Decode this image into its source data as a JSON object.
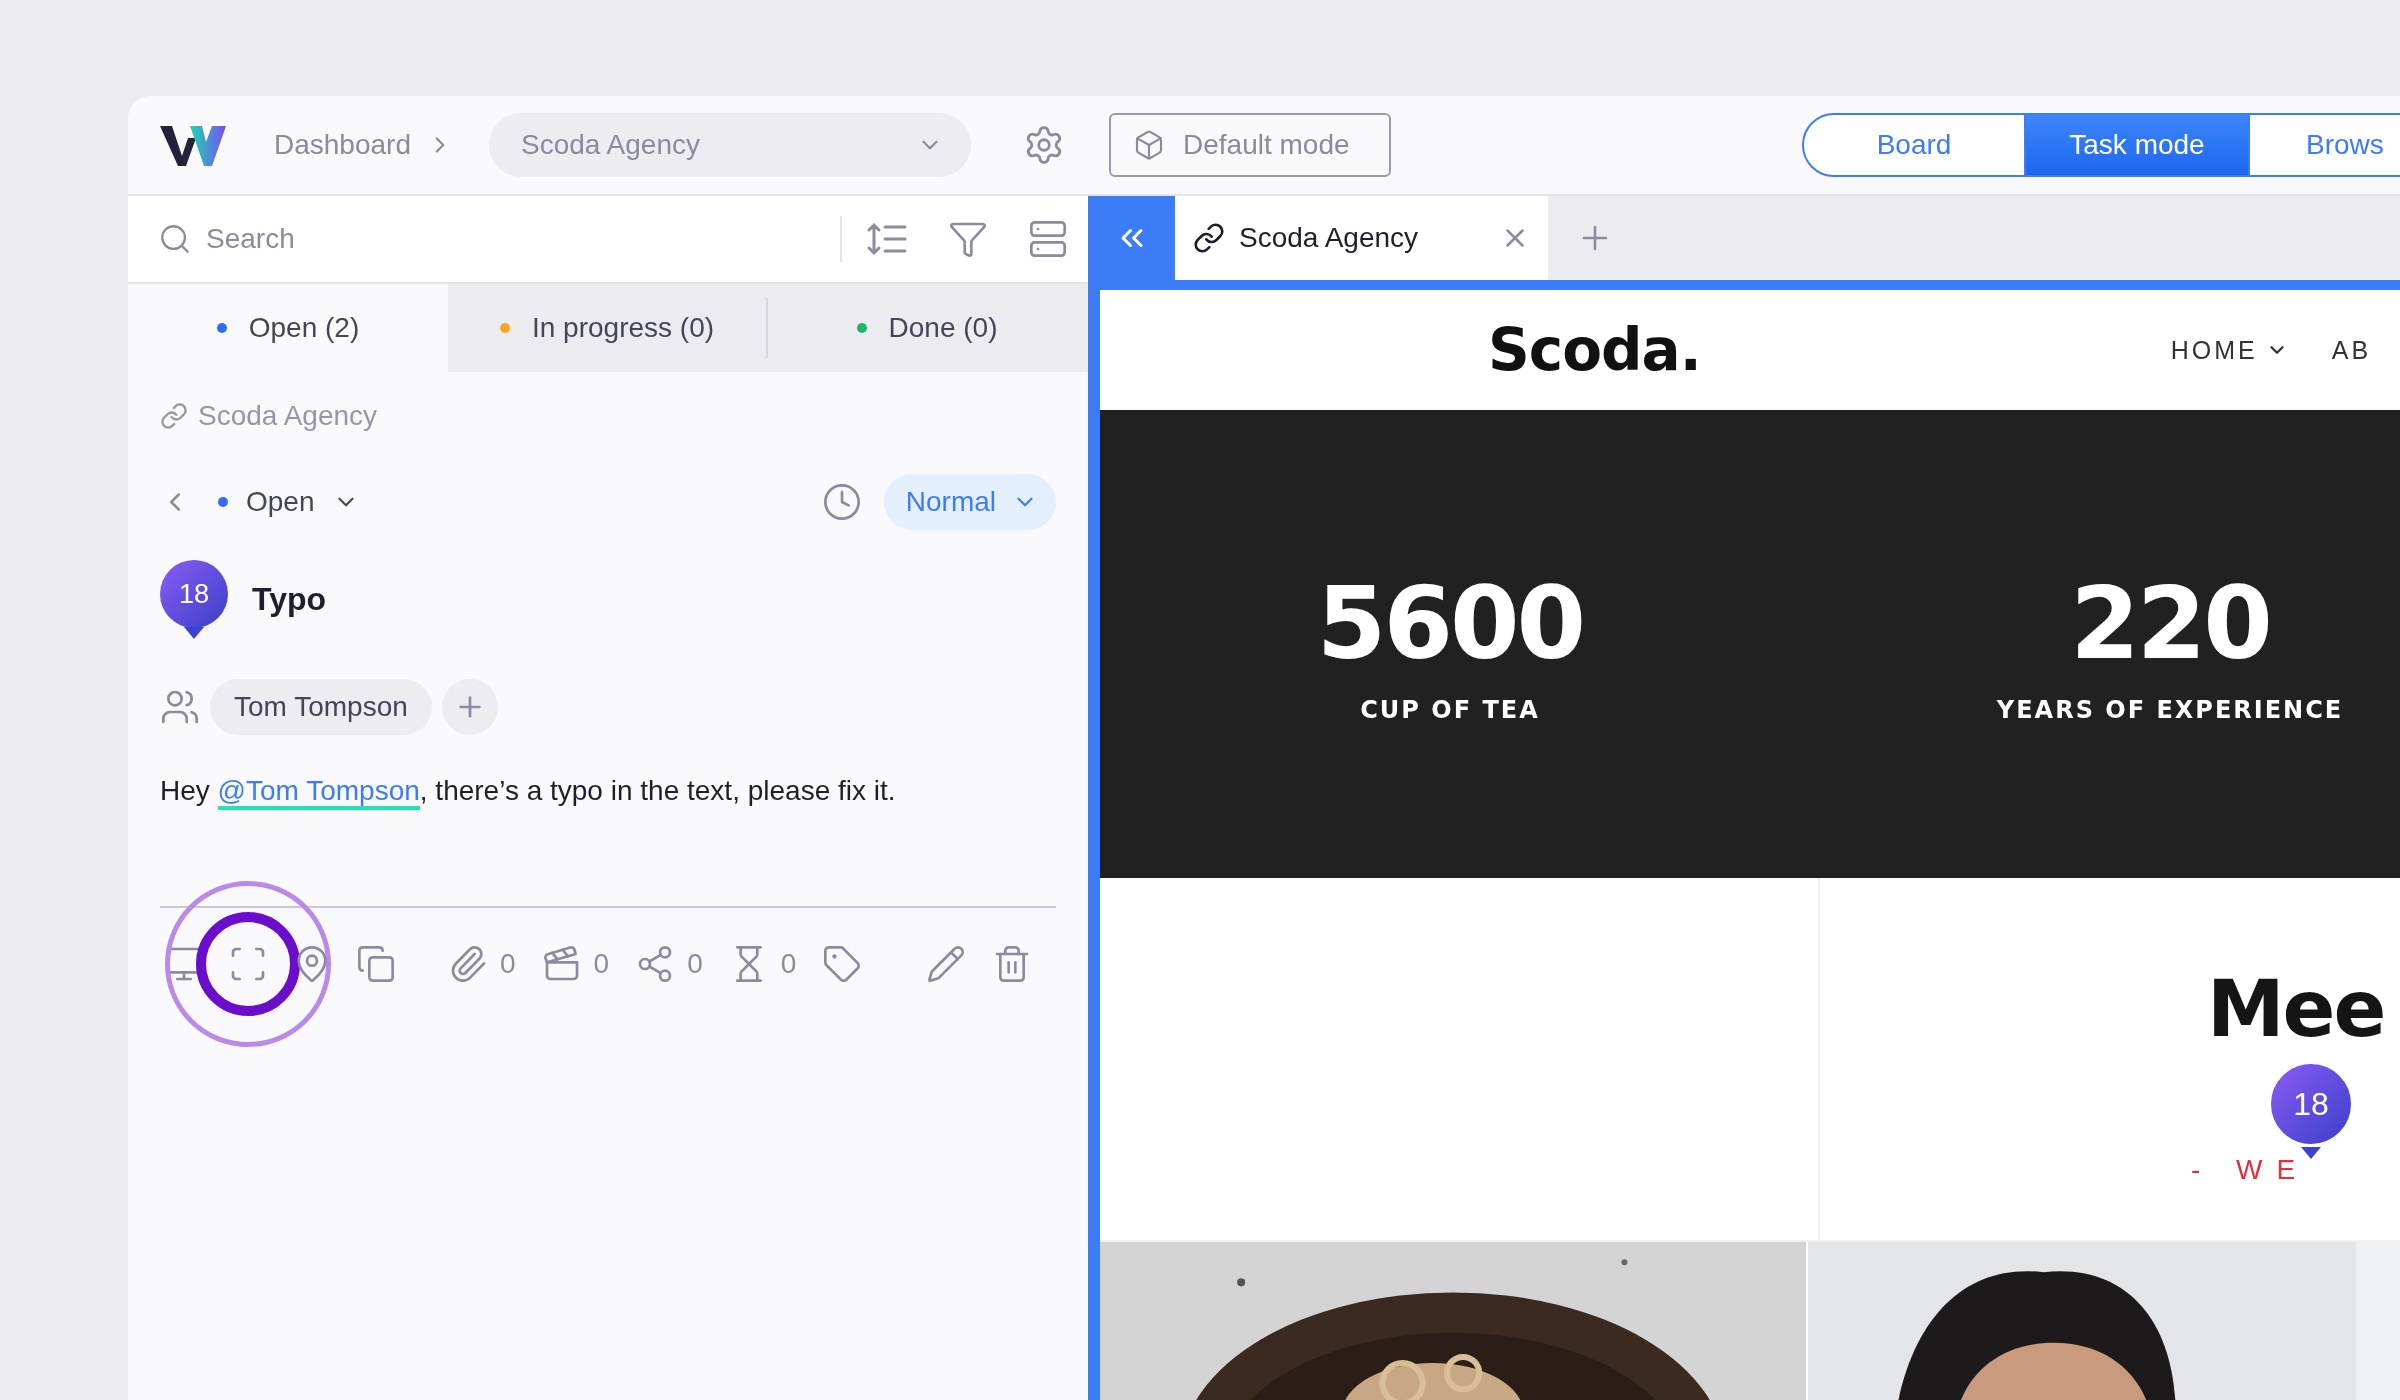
{
  "header": {
    "breadcrumb": "Dashboard",
    "project": "Scoda Agency",
    "mode_button": "Default mode",
    "view_tabs": [
      {
        "label": "Board",
        "selected": false
      },
      {
        "label": "Task mode",
        "selected": true
      },
      {
        "label": "Brows",
        "selected": false
      }
    ]
  },
  "sidebar": {
    "search": {
      "placeholder": "Search"
    },
    "status_tabs": [
      {
        "label": "Open (2)",
        "color": "#2f6bff",
        "selected": true
      },
      {
        "label": "In progress (0)",
        "color": "#f5a623",
        "selected": false
      },
      {
        "label": "Done (0)",
        "color": "#1fb46b",
        "selected": false
      }
    ],
    "task": {
      "link": "Scoda Agency",
      "status": "Open",
      "priority": "Normal",
      "number": "18",
      "title": "Typo",
      "assignees": [
        "Tom Tompson"
      ],
      "message": {
        "before": "Hey ",
        "mention": "@Tom Tompson",
        "after": ", there’s a typo in the text, please fix it."
      },
      "tools": [
        {
          "kind": "monitor",
          "highlighted": false
        },
        {
          "kind": "screenshot",
          "highlighted": true
        },
        {
          "kind": "pin",
          "highlighted": false
        },
        {
          "kind": "copy",
          "highlighted": false
        }
      ],
      "counters": [
        {
          "kind": "attachment",
          "count": "0"
        },
        {
          "kind": "video",
          "count": "0"
        },
        {
          "kind": "share",
          "count": "0"
        },
        {
          "kind": "time",
          "count": "0"
        }
      ],
      "actions": [
        {
          "kind": "tag"
        },
        {
          "kind": "edit"
        },
        {
          "kind": "delete"
        }
      ]
    }
  },
  "browser": {
    "tabs": [
      {
        "label": "Scoda Agency"
      }
    ],
    "site": {
      "logo": "Scoda.",
      "nav": [
        {
          "label": "HOME",
          "dropdown": true
        },
        {
          "label": "AB",
          "dropdown": false
        }
      ],
      "stats": [
        {
          "value": "5600",
          "label": "CUP OF TEA"
        },
        {
          "value": "220",
          "label": "YEARS OF EXPERIENCE"
        }
      ],
      "heading": "Mee",
      "subheading": "- WE",
      "pin": "18"
    }
  }
}
